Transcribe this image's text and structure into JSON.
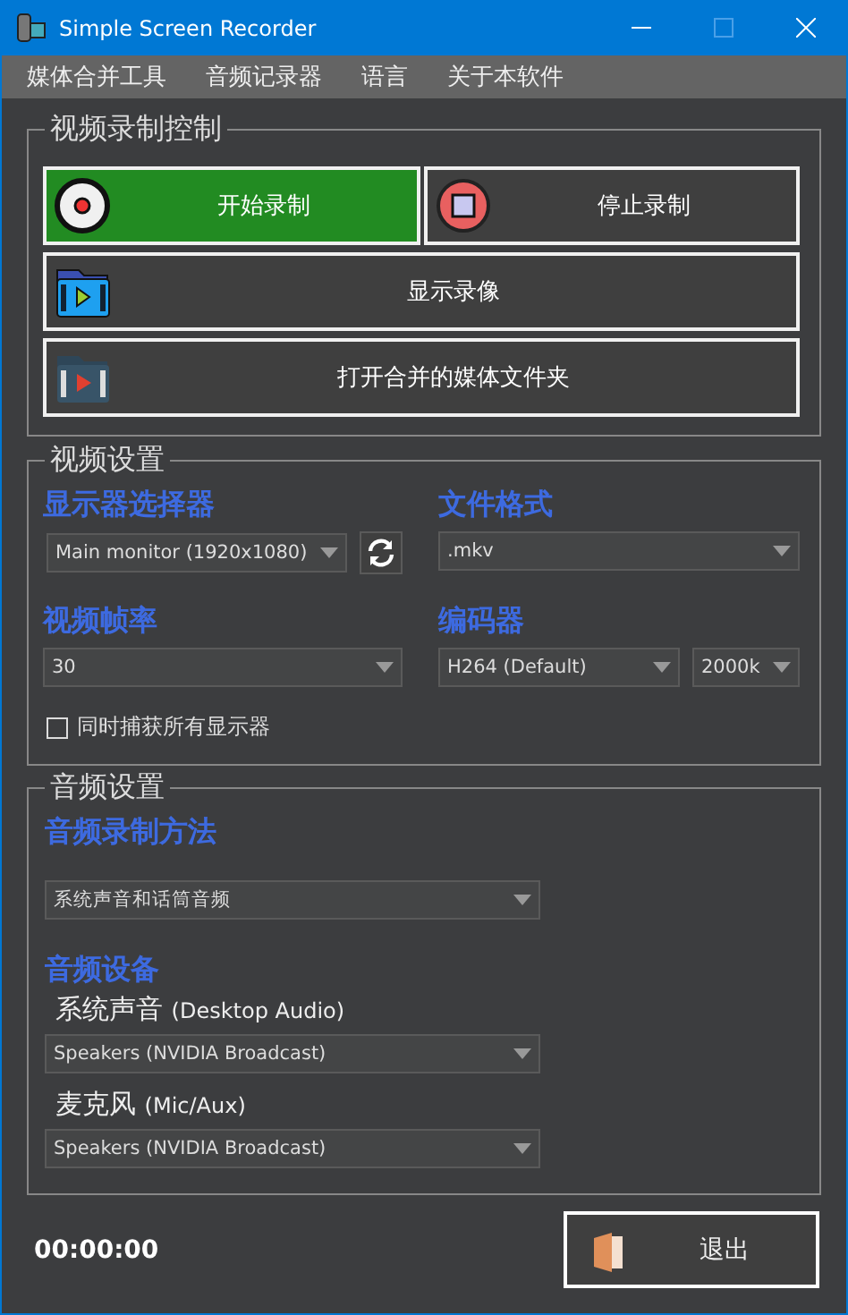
{
  "window": {
    "title": "Simple Screen Recorder"
  },
  "menu": [
    "媒体合并工具",
    "音频记录器",
    "语言",
    "关于本软件"
  ],
  "recording_control": {
    "title": "视频录制控制",
    "buttons": [
      {
        "kind": "start",
        "label": "开始录制",
        "active": true
      },
      {
        "kind": "stop",
        "label": "停止录制",
        "active": false
      },
      {
        "kind": "show",
        "label": "显示录像",
        "active": false
      },
      {
        "kind": "folder",
        "label": "打开合并的媒体文件夹",
        "active": false
      }
    ]
  },
  "video_settings": {
    "title": "视频设置",
    "monitor": {
      "label": "显示器选择器",
      "value": "Main monitor (1920x1080)"
    },
    "format": {
      "label": "文件格式",
      "value": ".mkv"
    },
    "framerate": {
      "label": "视频帧率",
      "value": "30"
    },
    "encoder": {
      "label": "编码器",
      "value": "H264 (Default)",
      "bitrate": "2000k"
    },
    "capture_all": {
      "label": "同时捕获所有显示器",
      "checked": false
    }
  },
  "audio_settings": {
    "title": "音频设置",
    "method": {
      "label": "音频录制方法",
      "value": "系统声音和话筒音频"
    },
    "devices_label": "音频设备",
    "devices": [
      {
        "label": "系统声音",
        "sub": "(Desktop Audio)",
        "value": "Speakers (NVIDIA Broadcast)"
      },
      {
        "label": "麦克风",
        "sub": "(Mic/Aux)",
        "value": "Speakers (NVIDIA Broadcast)"
      }
    ]
  },
  "footer": {
    "time": "00:00:00",
    "exit": "退出"
  }
}
